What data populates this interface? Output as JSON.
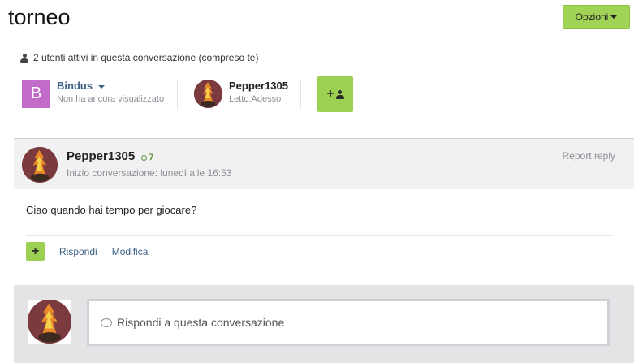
{
  "title": "torneo",
  "options_label": "Opzioni",
  "active_users": "2 utenti attivi in questa conversazione (compreso te)",
  "participants": [
    {
      "initial": "B",
      "name": "Bindus",
      "status": "Non ha ancora visualizzato",
      "avatar_color": "#c26bc9"
    },
    {
      "name": "Pepper1305",
      "status": "Letto:Adesso"
    }
  ],
  "post": {
    "author": "Pepper1305",
    "reputation": "7",
    "date": "Inizio conversazione: lunedì alle 16:53",
    "report": "Report reply",
    "body": "Ciao quando hai tempo per giocare?",
    "actions": {
      "reply": "Rispondi",
      "edit": "Modifica"
    }
  },
  "reply_placeholder": "Rispondi a questa conversazione",
  "colors": {
    "accent": "#9bd052",
    "link": "#3b5f85",
    "muted": "#8a8f96"
  },
  "icons": [
    "user-icon",
    "caret-down-icon",
    "add-user-icon",
    "plus-icon",
    "reputation-icon",
    "speech-bubble-icon"
  ]
}
